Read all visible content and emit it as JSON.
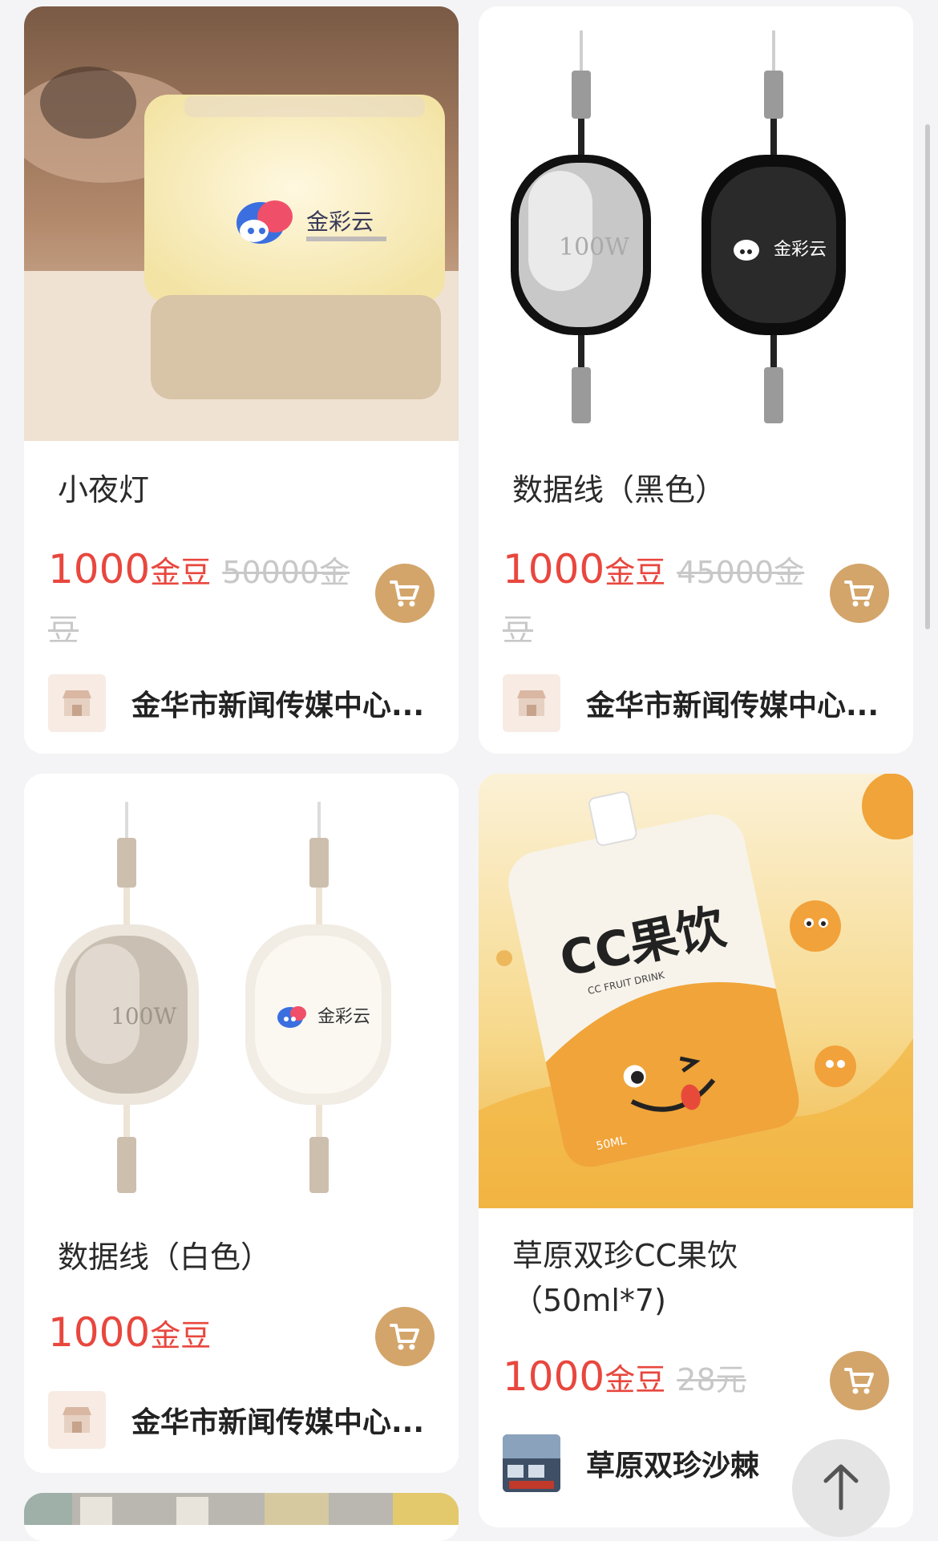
{
  "products": [
    {
      "title": "小夜灯",
      "price": "1000",
      "unit": "金豆",
      "original_price": "50000金豆",
      "shop_name": "金华市新闻传媒中心..."
    },
    {
      "title": "数据线（黑色）",
      "price": "1000",
      "unit": "金豆",
      "original_price": "45000金豆",
      "shop_name": "金华市新闻传媒中心..."
    },
    {
      "title": "数据线（白色）",
      "price": "1000",
      "unit": "金豆",
      "original_price": "",
      "shop_name": "金华市新闻传媒中心..."
    },
    {
      "title": "草原双珍CC果饮（50ml*7)",
      "price": "1000",
      "unit": "金豆",
      "original_price": "28元",
      "shop_name": "草原双珍沙棘"
    }
  ],
  "image_text": {
    "brand_name": "金彩云",
    "cable_label": "100W",
    "drink_brand": "CC果饮",
    "drink_sub": "CC FRUIT DRINK",
    "drink_volume": "50ML"
  },
  "icons": {
    "cart": "shopping-cart-icon",
    "back_to_top": "arrow-up-icon",
    "shop": "storefront-icon"
  },
  "colors": {
    "price_red": "#e8473e",
    "cart_gold": "#d3a56b",
    "background": "#f4f4f6"
  }
}
